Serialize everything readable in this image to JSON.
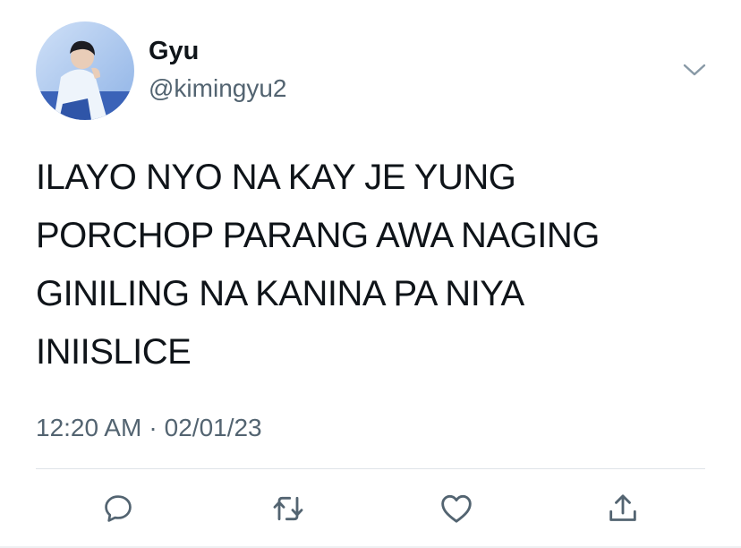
{
  "user": {
    "display_name": "Gyu",
    "handle": "@kimingyu2"
  },
  "tweet": {
    "text": "ILAYO NYO NA KAY JE YUNG\nPORCHOP PARANG AWA NAGING\nGINILING NA KANINA PA NIYA\nINIISLICE",
    "time": "12:20 AM",
    "separator": "·",
    "date": "02/01/23"
  },
  "icons": {
    "menu": "chevron-down-icon",
    "reply": "reply-icon",
    "retweet": "retweet-icon",
    "like": "heart-icon",
    "share": "share-icon"
  },
  "colors": {
    "text": "#0f1419",
    "secondary": "#536471",
    "icon": "#536471",
    "divider": "#dfe3e8"
  }
}
